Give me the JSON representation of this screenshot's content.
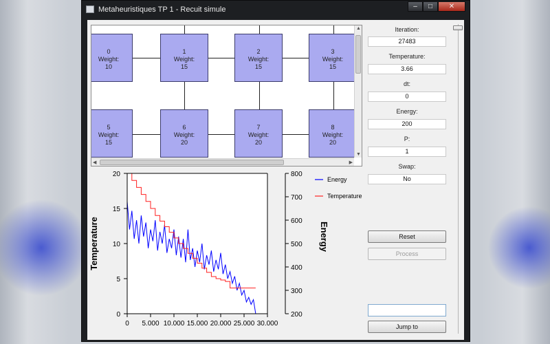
{
  "window": {
    "title": "Metaheuristiques TP 1 - Recuit simule"
  },
  "graph": {
    "weight_label": "Weight:",
    "nodes": [
      {
        "id": "0",
        "weight": "10"
      },
      {
        "id": "1",
        "weight": "15"
      },
      {
        "id": "2",
        "weight": "15"
      },
      {
        "id": "3",
        "weight": "15"
      },
      {
        "id": "5",
        "weight": "15"
      },
      {
        "id": "6",
        "weight": "20"
      },
      {
        "id": "7",
        "weight": "20"
      },
      {
        "id": "8",
        "weight": "20"
      }
    ]
  },
  "stats": {
    "iteration_label": "Iteration:",
    "iteration": "27483",
    "temperature_label": "Temperature:",
    "temperature": "3.66",
    "dt_label": "dt:",
    "dt": "0",
    "energy_label": "Energy:",
    "energy": "200",
    "p_label": "P:",
    "p": "1",
    "swap_label": "Swap:",
    "swap": "No"
  },
  "buttons": {
    "reset": "Reset",
    "process": "Process",
    "jump_to": "Jump to"
  },
  "jump_input": {
    "value": ""
  },
  "colors": {
    "node_fill": "#aaaaf0",
    "energy": "#0000ff",
    "temperature": "#ff2020"
  },
  "chart_data": {
    "type": "line",
    "title": "",
    "xlabel": "",
    "ylabel_left": "Temperature",
    "ylabel_right": "Energy",
    "xlim": [
      0,
      30000
    ],
    "ylim_left": [
      0,
      20
    ],
    "ylim_right": [
      200,
      800
    ],
    "x_ticks": [
      "0",
      "5.000",
      "10.000",
      "15.000",
      "20.000",
      "25.000",
      "30.000"
    ],
    "y_ticks_left": [
      "0",
      "5",
      "10",
      "15",
      "20"
    ],
    "y_ticks_right": [
      "200",
      "300",
      "400",
      "500",
      "600",
      "700",
      "800"
    ],
    "legend": [
      "Energy",
      "Temperature"
    ],
    "legend_position": "right",
    "series": [
      {
        "name": "Energy",
        "axis": "right",
        "x": [
          0,
          500,
          1000,
          1500,
          2000,
          2500,
          3000,
          3500,
          4000,
          4500,
          5000,
          5500,
          6000,
          6500,
          7000,
          7500,
          8000,
          8500,
          9000,
          9500,
          10000,
          10500,
          11000,
          11500,
          12000,
          12500,
          13000,
          13500,
          14000,
          14500,
          15000,
          15500,
          16000,
          16500,
          17000,
          17500,
          18000,
          18500,
          19000,
          19500,
          20000,
          20500,
          21000,
          21500,
          22000,
          22500,
          23000,
          23500,
          24000,
          24500,
          25000,
          25500,
          26000,
          26500,
          27000,
          27483
        ],
        "y": [
          680,
          560,
          640,
          520,
          600,
          500,
          620,
          530,
          590,
          480,
          560,
          510,
          600,
          470,
          550,
          500,
          580,
          460,
          520,
          480,
          560,
          450,
          530,
          440,
          520,
          420,
          560,
          430,
          480,
          400,
          470,
          420,
          500,
          390,
          450,
          410,
          470,
          380,
          430,
          390,
          460,
          370,
          410,
          350,
          380,
          330,
          360,
          300,
          330,
          280,
          300,
          250,
          270,
          240,
          260,
          200
        ]
      },
      {
        "name": "Temperature",
        "axis": "left",
        "x": [
          0,
          1000,
          2000,
          3000,
          4000,
          5000,
          6000,
          7000,
          8000,
          9000,
          10000,
          11000,
          12000,
          13000,
          14000,
          15000,
          16000,
          17000,
          18000,
          19000,
          20000,
          21000,
          22000,
          27483
        ],
        "y": [
          20,
          19,
          18,
          17,
          16,
          15,
          14,
          13.2,
          12.4,
          11.6,
          10.8,
          10,
          9.3,
          8.6,
          7.9,
          7.2,
          6.5,
          5.9,
          5.3,
          5,
          4.8,
          4.6,
          3.66,
          3.66
        ]
      }
    ]
  }
}
